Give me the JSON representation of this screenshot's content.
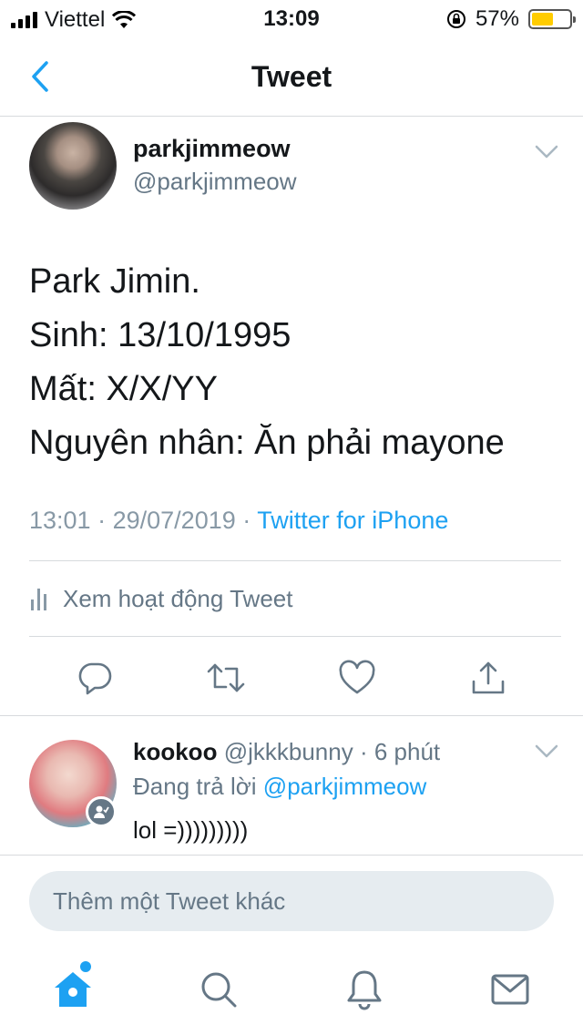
{
  "status_bar": {
    "carrier": "Viettel",
    "time": "13:09",
    "battery_percent": "57%",
    "battery_level": 0.57,
    "battery_color": "#ffcc00",
    "icons": [
      "signal-icon",
      "wifi-icon",
      "orientation-lock-icon",
      "battery-icon"
    ]
  },
  "nav": {
    "title": "Tweet",
    "back_icon": "chevron-left-icon"
  },
  "tweet": {
    "author_name": "parkjimmeow",
    "author_handle": "@parkjimmeow",
    "lines": [
      "Park Jimin.",
      "Sinh: 13/10/1995",
      "Mất: X/X/YY",
      "Nguyên nhân: Ăn phải mayone"
    ],
    "time": "13:01",
    "date": "29/07/2019",
    "separator": "·",
    "source": "Twitter for iPhone",
    "activity_label": "Xem hoạt động Tweet",
    "action_icons": [
      "reply-icon",
      "retweet-icon",
      "like-icon",
      "share-icon"
    ]
  },
  "reply": {
    "author_name": "kookoo",
    "author_handle": "@jkkkbunny",
    "separator": "·",
    "age": "6 phút",
    "replying_prefix": "Đang trả lời",
    "replying_to": "@parkjimmeow",
    "text": "lol =)))))))))"
  },
  "compose": {
    "placeholder": "Thêm một Tweet khác"
  },
  "tabbar": {
    "items": [
      "home-icon",
      "search-icon",
      "notifications-icon",
      "messages-icon"
    ]
  },
  "colors": {
    "accent": "#1da1f2",
    "secondary_text": "#657786",
    "divider": "#d7dadd"
  }
}
